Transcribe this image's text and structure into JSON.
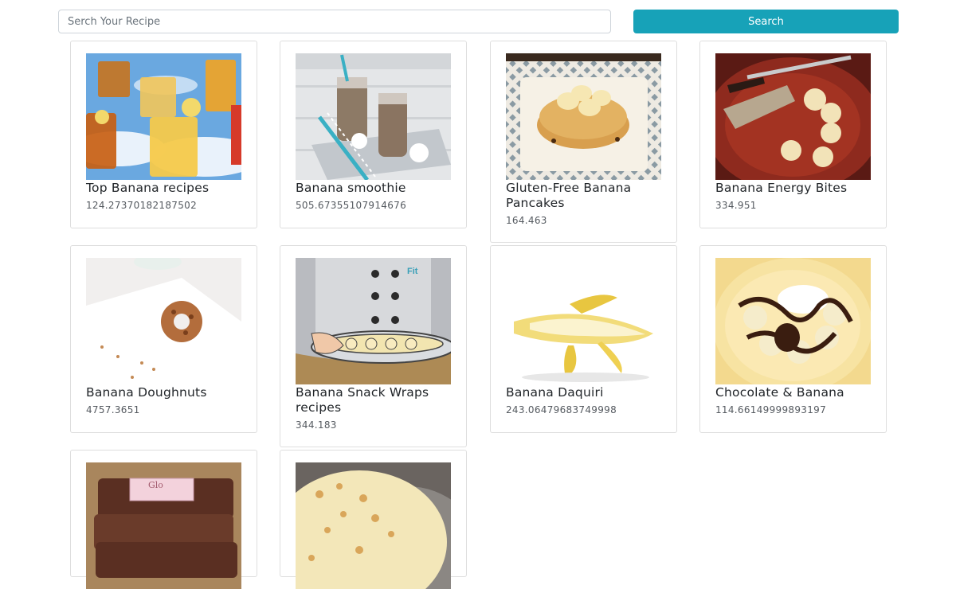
{
  "search": {
    "placeholder": "Serch Your Recipe",
    "value": "",
    "button_label": "Search"
  },
  "accent_color": "#17a2b8",
  "recipes": [
    {
      "title": "Top Banana recipes",
      "score": "124.27370182187502",
      "image": "iced-drinks-image"
    },
    {
      "title": "Banana smoothie",
      "score": "505.67355107914676",
      "image": "smoothie-jars-image"
    },
    {
      "title": "Gluten-Free Banana Pancakes",
      "score": "164.463",
      "image": "pancakes-image"
    },
    {
      "title": "Banana Energy Bites",
      "score": "334.951",
      "image": "energy-bites-image"
    },
    {
      "title": "Banana Doughnuts",
      "score": "4757.3651",
      "image": "doughnut-image"
    },
    {
      "title": "Banana Snack Wraps recipes",
      "score": "344.183",
      "image": "chef-tray-image"
    },
    {
      "title": "Banana Daquiri",
      "score": "243.06479683749998",
      "image": "peeled-banana-image"
    },
    {
      "title": "Chocolate & Banana",
      "score": "114.66149999893197",
      "image": "chocolate-banana-image"
    },
    {
      "title": "",
      "score": "",
      "image": "snack-bar-image",
      "label_text": "Glo"
    },
    {
      "title": "",
      "score": "",
      "image": "banana-pudding-image"
    }
  ]
}
